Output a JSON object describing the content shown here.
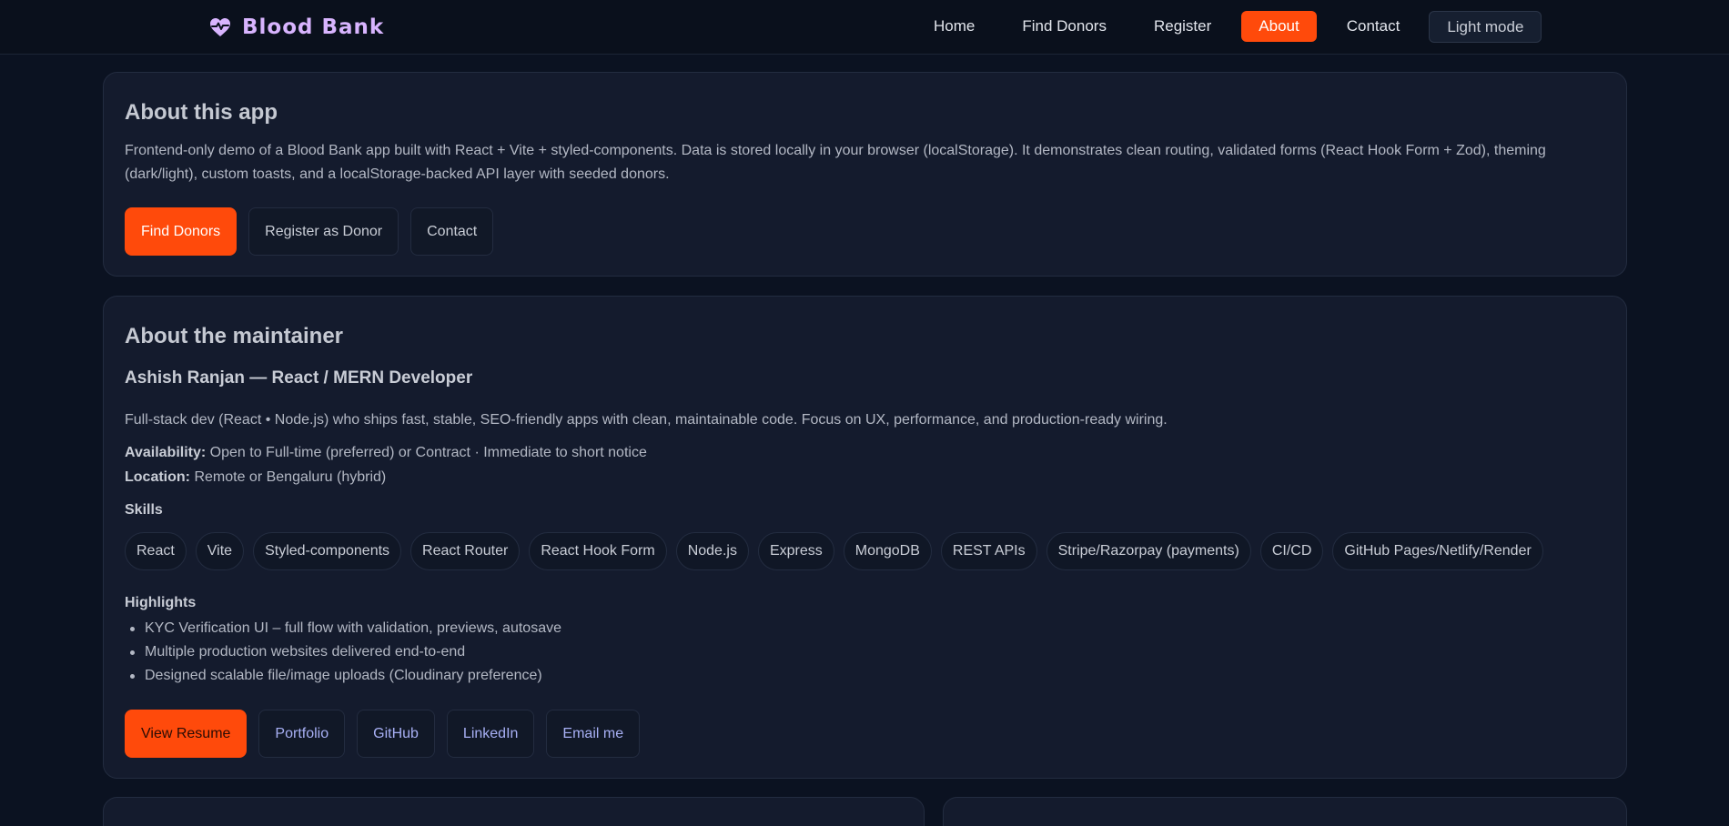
{
  "brand": {
    "name": "Blood Bank",
    "icon": "heart-pulse-icon",
    "color": "#d8b4fe"
  },
  "nav": {
    "items": [
      {
        "label": "Home"
      },
      {
        "label": "Find Donors"
      },
      {
        "label": "Register"
      },
      {
        "label": "About",
        "active": true
      },
      {
        "label": "Contact"
      }
    ],
    "theme_toggle": "Light mode"
  },
  "about_app": {
    "title": "About this app",
    "description": "Frontend-only demo of a Blood Bank app built with React + Vite + styled-components. Data is stored locally in your browser (localStorage). It demonstrates clean routing, validated forms (React Hook Form + Zod), theming (dark/light), custom toasts, and a localStorage-backed API layer with seeded donors.",
    "buttons": [
      "Find Donors",
      "Register as Donor",
      "Contact"
    ]
  },
  "maintainer": {
    "title": "About the maintainer",
    "name_line": "Ashish Ranjan — React / MERN Developer",
    "bio": "Full-stack dev (React • Node.js) who ships fast, stable, SEO-friendly apps with clean, maintainable code. Focus on UX, performance, and production-ready wiring.",
    "availability_label": "Availability:",
    "availability": "Open to Full-time (preferred) or Contract · Immediate to short notice",
    "location_label": "Location:",
    "location": "Remote or Bengaluru (hybrid)",
    "skills_title": "Skills",
    "skills": [
      "React",
      "Vite",
      "Styled-components",
      "React Router",
      "React Hook Form",
      "Node.js",
      "Express",
      "MongoDB",
      "REST APIs",
      "Stripe/Razorpay (payments)",
      "CI/CD",
      "GitHub Pages/Netlify/Render"
    ],
    "highlights_title": "Highlights",
    "highlights": [
      "KYC Verification UI – full flow with validation, previews, autosave",
      "Multiple production websites delivered end-to-end",
      "Designed scalable file/image uploads (Cloudinary preference)"
    ],
    "links": [
      "View Resume",
      "Portfolio",
      "GitHub",
      "LinkedIn",
      "Email me"
    ]
  },
  "colors": {
    "accent": "#ff4a0b",
    "background": "#0b1221",
    "card": "#141b2d"
  }
}
